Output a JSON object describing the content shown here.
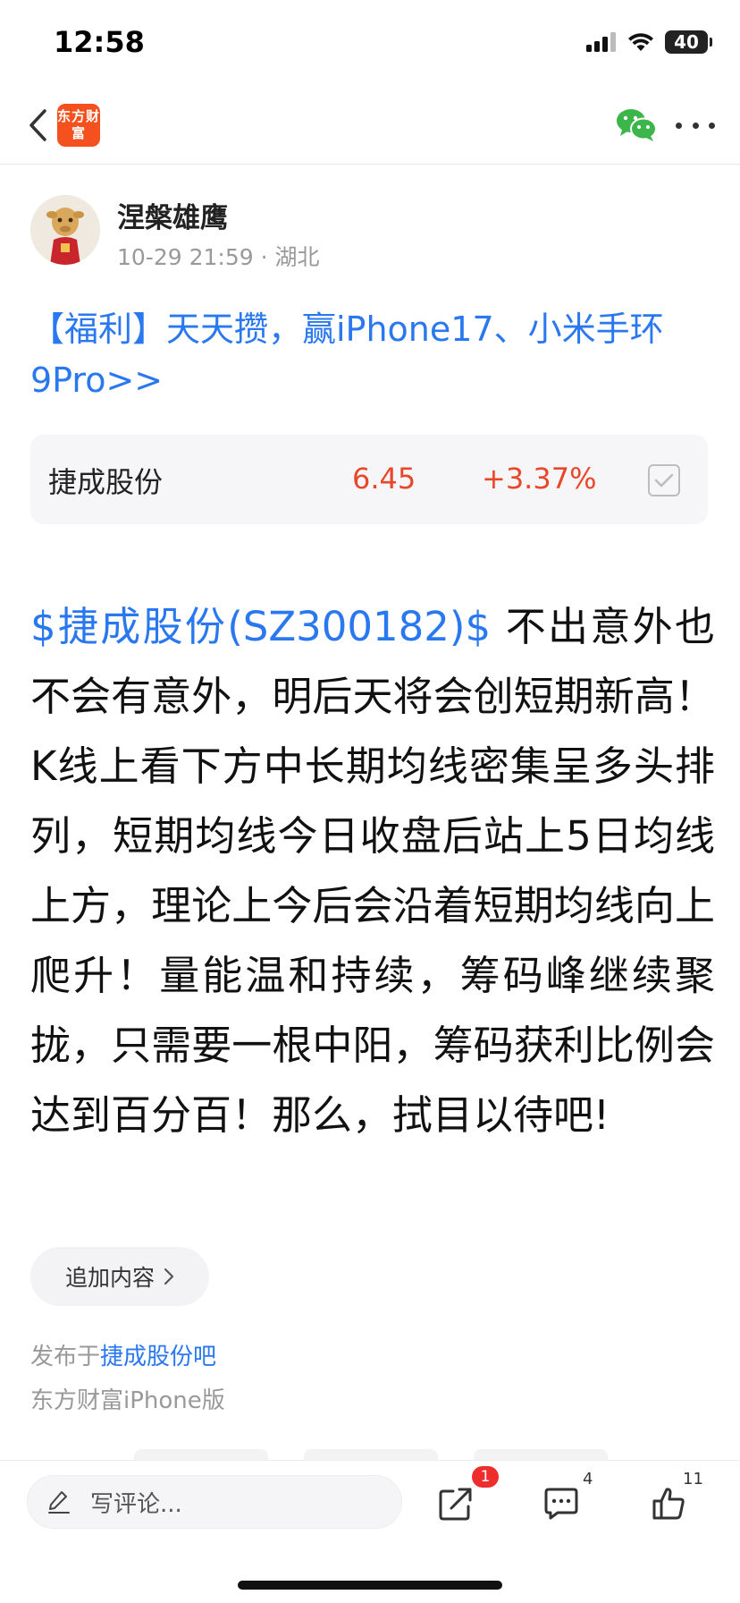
{
  "status_bar": {
    "time": "12:58",
    "battery": "40"
  },
  "nav": {
    "logo_text": "东方财富",
    "logo_color": "#f4511e"
  },
  "post": {
    "author": "涅槃雄鹰",
    "datetime": "10-29 21:59",
    "separator": "·",
    "location": "湖北",
    "promo": "【福利】天天攒，赢iPhone17、小米手环9Pro>>",
    "stock_card": {
      "name": "捷成股份",
      "price": "6.45",
      "change": "+3.37%"
    },
    "stock_tag": "$捷成股份(SZ300182)$",
    "body": "  不出意外也不会有意外，明后天将会创短期新高！K线上看下方中长期均线密集呈多头排列，短期均线今日收盘后站上5日均线上方，理论上今后会沿着短期均线向上爬升！量能温和持续，筹码峰继续聚拢，只需要一根中阳，筹码获利比例会达到百分百！那么，拭目以待吧!",
    "append_label": "追加内容",
    "published_prefix": "发布于",
    "published_bar": "捷成股份吧",
    "client": "东方财富iPhone版"
  },
  "bottom_bar": {
    "comment_placeholder": "写评论...",
    "share_badge": "1",
    "comment_count": "4",
    "like_count": "11"
  },
  "colors": {
    "link": "#2a78f0",
    "rise": "#e8472a",
    "badge": "#ee2d2d"
  },
  "icons": [
    "back-icon",
    "wechat-icon",
    "more-icon",
    "checkbox-icon",
    "chevron-right-icon",
    "pencil-icon",
    "share-icon",
    "comment-icon",
    "like-icon"
  ]
}
